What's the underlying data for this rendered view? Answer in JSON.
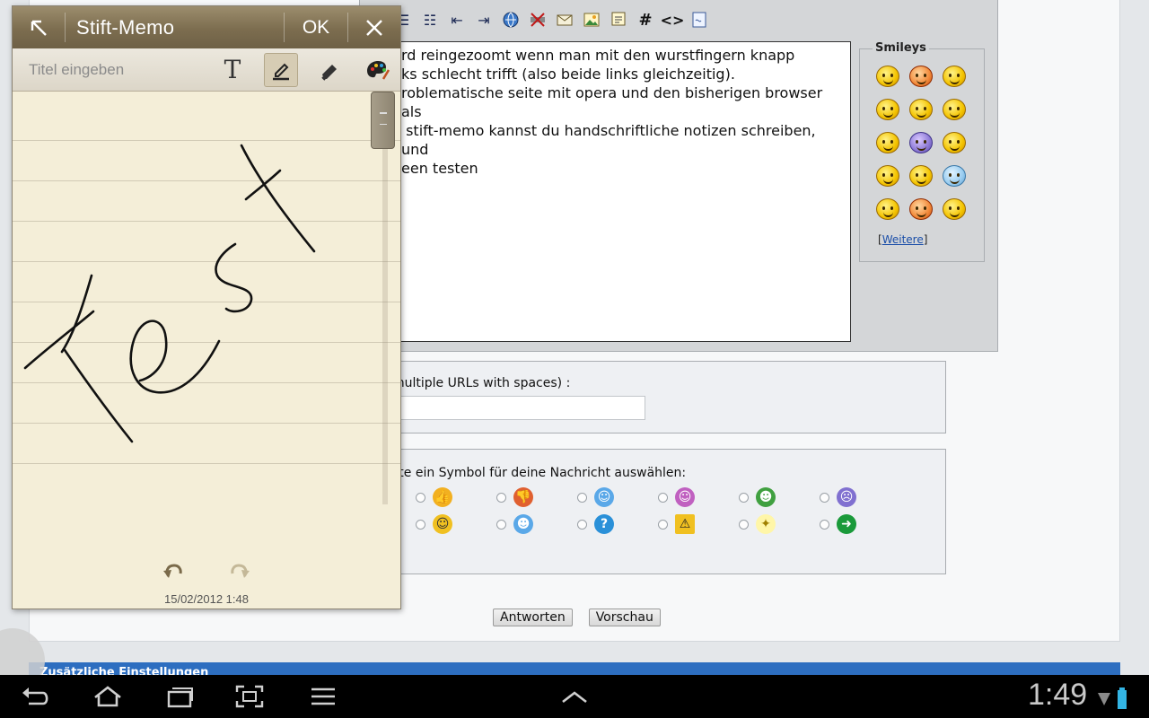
{
  "forum": {
    "message_lines": [
      "rd reingezoomt wenn man mit den wurstfingern knapp",
      "ks schlecht trifft (also beide links gleichzeitig).",
      "roblematische seite mit opera und den bisherigen browser als",
      "",
      " stift-memo kannst du handschriftliche notizen schreiben, und",
      "een testen"
    ],
    "smileys_legend": "Smileys",
    "smileys_more": "Weitere",
    "url_label": "multiple URLs with spaces) :",
    "icon_label": "ste ein Symbol für deine Nachricht auswählen:",
    "reply_button": "Antworten",
    "preview_button": "Vorschau",
    "bottom_bar_text": "Zusätzliche Einstellungen"
  },
  "memo": {
    "title": "Stift-Memo",
    "ok_label": "OK",
    "title_placeholder": "Titel eingeben",
    "text_tool_label": "T",
    "date": "15/02/2012 1:48",
    "active_tool": "pen-icon"
  },
  "statusbar": {
    "clock": "1:49"
  },
  "colors": {
    "memo_titlebar": "#7c6d4f",
    "memo_paper": "#f4eed8",
    "forum_panel": "#d4d6d8",
    "system_bar": "#000000",
    "battery": "#33b5e5"
  }
}
